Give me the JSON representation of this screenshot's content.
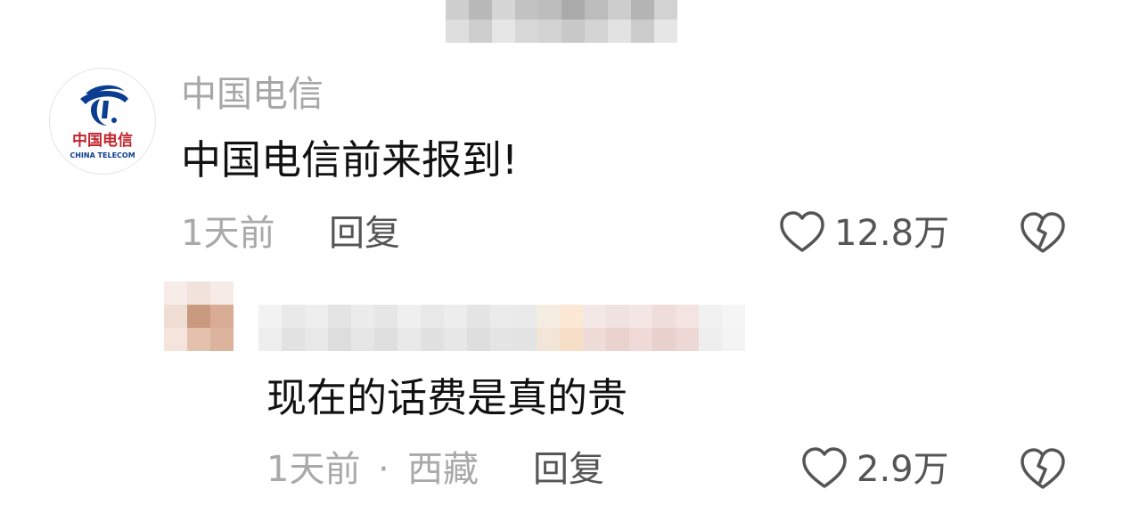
{
  "top_blurred_strip": "",
  "comment1": {
    "avatar_logo_cn": "中国电信",
    "avatar_logo_en": "CHINA TELECOM",
    "author": "中国电信",
    "text": "中国电信前来报到!",
    "time": "1天前",
    "reply_label": "回复",
    "like_count": "12.8万"
  },
  "comment2": {
    "text": "现在的话费是真的贵",
    "time": "1天前",
    "separator": "·",
    "location": "西藏",
    "reply_label": "回复",
    "like_count": "2.9万"
  },
  "colors": {
    "brand_blue": "#0b3d91",
    "meta_gray": "#a9a9a9",
    "text_dark": "#111111"
  }
}
